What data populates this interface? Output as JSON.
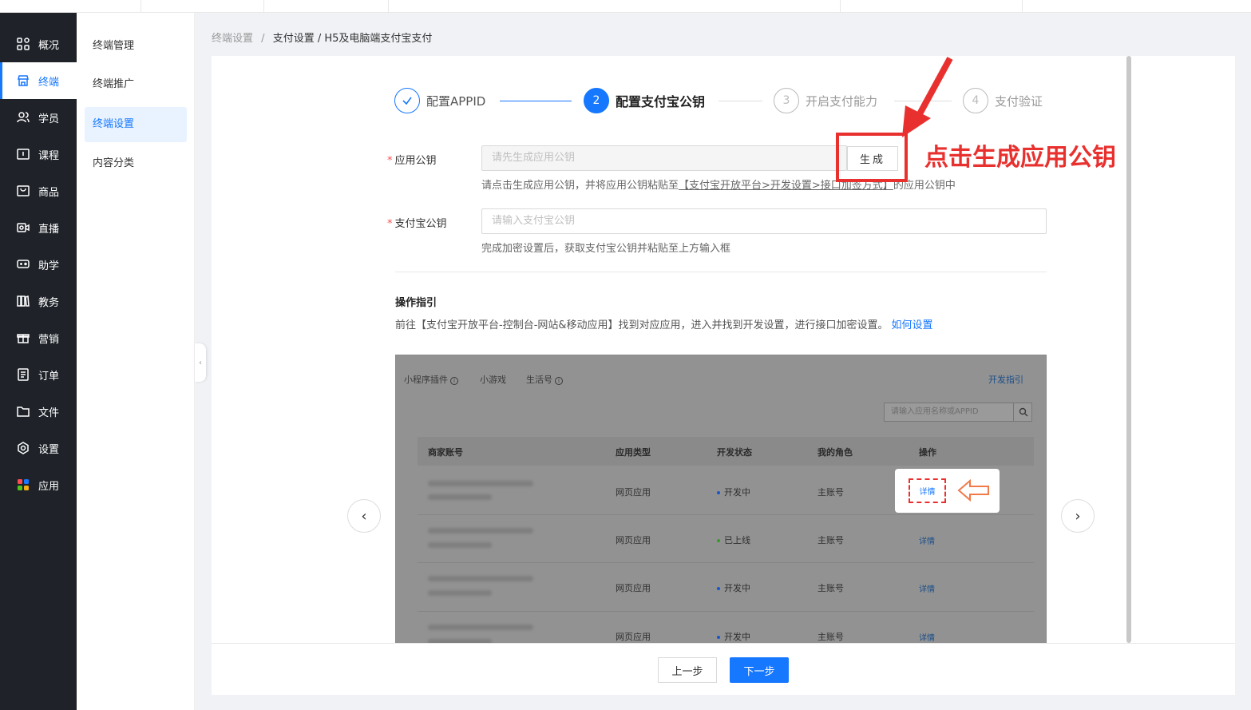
{
  "sidebar": {
    "items": [
      {
        "icon": "grid-icon",
        "label": "概况"
      },
      {
        "icon": "store-icon",
        "label": "终端"
      },
      {
        "icon": "users-icon",
        "label": "学员"
      },
      {
        "icon": "course-icon",
        "label": "课程"
      },
      {
        "icon": "product-icon",
        "label": "商品"
      },
      {
        "icon": "live-icon",
        "label": "直播"
      },
      {
        "icon": "gamepad-icon",
        "label": "助学"
      },
      {
        "icon": "books-icon",
        "label": "教务"
      },
      {
        "icon": "gift-icon",
        "label": "营销"
      },
      {
        "icon": "order-icon",
        "label": "订单"
      },
      {
        "icon": "folder-icon",
        "label": "文件"
      },
      {
        "icon": "gear-icon",
        "label": "设置"
      },
      {
        "icon": "apps-icon",
        "label": "应用"
      }
    ]
  },
  "subnav": {
    "items": [
      "终端管理",
      "终端推广",
      "终端设置",
      "内容分类"
    ]
  },
  "breadcrumb": [
    "终端设置",
    "/",
    "支付设置 / H5及电脑端支付宝支付"
  ],
  "steps": [
    {
      "num": "1",
      "label": "配置APPID",
      "state": "done"
    },
    {
      "num": "2",
      "label": "配置支付宝公钥",
      "state": "current"
    },
    {
      "num": "3",
      "label": "开启支付能力",
      "state": "todo"
    },
    {
      "num": "4",
      "label": "支付验证",
      "state": "todo"
    }
  ],
  "form": {
    "app_key_label": "应用公钥",
    "app_key_placeholder": "请先生成应用公钥",
    "generate_label": "生成",
    "app_key_help_pre": "请点击生成应用公钥，并将应用公钥粘贴至",
    "app_key_help_link": "【支付宝开放平台>开发设置>接口加签方式】",
    "app_key_help_post": "的应用公钥中",
    "alipay_key_label": "支付宝公钥",
    "alipay_key_placeholder": "请输入支付宝公钥",
    "alipay_key_help": "完成加密设置后，获取支付宝公钥并粘贴至上方输入框"
  },
  "annotation": "点击生成应用公钥",
  "guide": {
    "title": "操作指引",
    "desc": "前往【支付宝开放平台-控制台-网站&移动应用】找到对应应用，进入并找到开发设置，进行接口加密设置。",
    "link": "如何设置"
  },
  "screenshot": {
    "tabs": [
      "小程序插件",
      "小游戏",
      "生活号"
    ],
    "dev_guide": "开发指引",
    "search_placeholder": "请输入应用名称或APPID",
    "columns": [
      "商家账号",
      "应用类型",
      "开发状态",
      "我的角色",
      "操作"
    ],
    "rows": [
      {
        "type": "网页应用",
        "status": "开发中",
        "status_color": "#1a56c8",
        "role": "主账号",
        "action": "详情"
      },
      {
        "type": "网页应用",
        "status": "已上线",
        "status_color": "#3a9a2a",
        "role": "主账号",
        "action": "详情"
      },
      {
        "type": "网页应用",
        "status": "开发中",
        "status_color": "#1a56c8",
        "role": "主账号",
        "action": "详情"
      },
      {
        "type": "网页应用",
        "status": "开发中",
        "status_color": "#1a56c8",
        "role": "主账号",
        "action": "详情"
      }
    ]
  },
  "footer": {
    "prev": "上一步",
    "next": "下一步"
  },
  "colors": {
    "primary": "#1677ff",
    "annotation": "#e8312f",
    "sidebar_bg": "#1f2329"
  }
}
